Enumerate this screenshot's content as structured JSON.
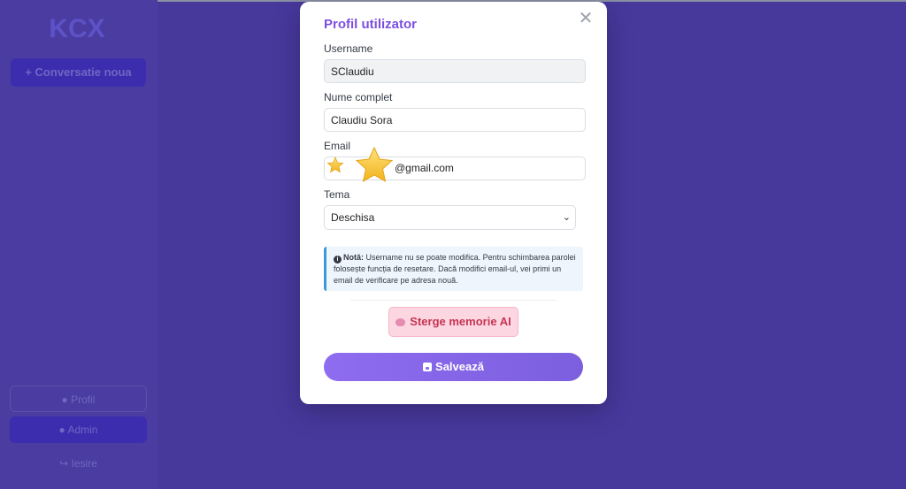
{
  "sidebar": {
    "logo_text": "KCX",
    "new_conversation_label": "+ Conversatie noua",
    "profile_label": "Profil",
    "admin_label": "Admin",
    "logout_label": "Iesire"
  },
  "modal": {
    "title": "Profil utilizator",
    "close_symbol": "✕",
    "username": {
      "label": "Username",
      "value": "SClaudiu"
    },
    "full_name": {
      "label": "Nume complet",
      "value": "Claudiu Sora"
    },
    "email": {
      "label": "Email",
      "value": "@gmail.com"
    },
    "theme": {
      "label": "Tema",
      "selected": "Deschisa"
    },
    "note": {
      "prefix": "Notă:",
      "text": "Username nu se poate modifica. Pentru schimbarea parolei folosește funcția de resetare. Dacă modifici email-ul, vei primi un email de verificare pe adresa nouă."
    },
    "clear_memory_label": "Sterge memorie AI",
    "save_label": "Salvează"
  },
  "colors": {
    "backdrop": "#47389c",
    "accent": "#7c4fe0",
    "danger": "#c63553",
    "info": "#3a9ad9"
  },
  "icons": [
    "close-icon",
    "info-icon",
    "brain-icon",
    "floppy-disk-icon",
    "user-icon",
    "users-icon",
    "logout-icon",
    "star-icon"
  ]
}
